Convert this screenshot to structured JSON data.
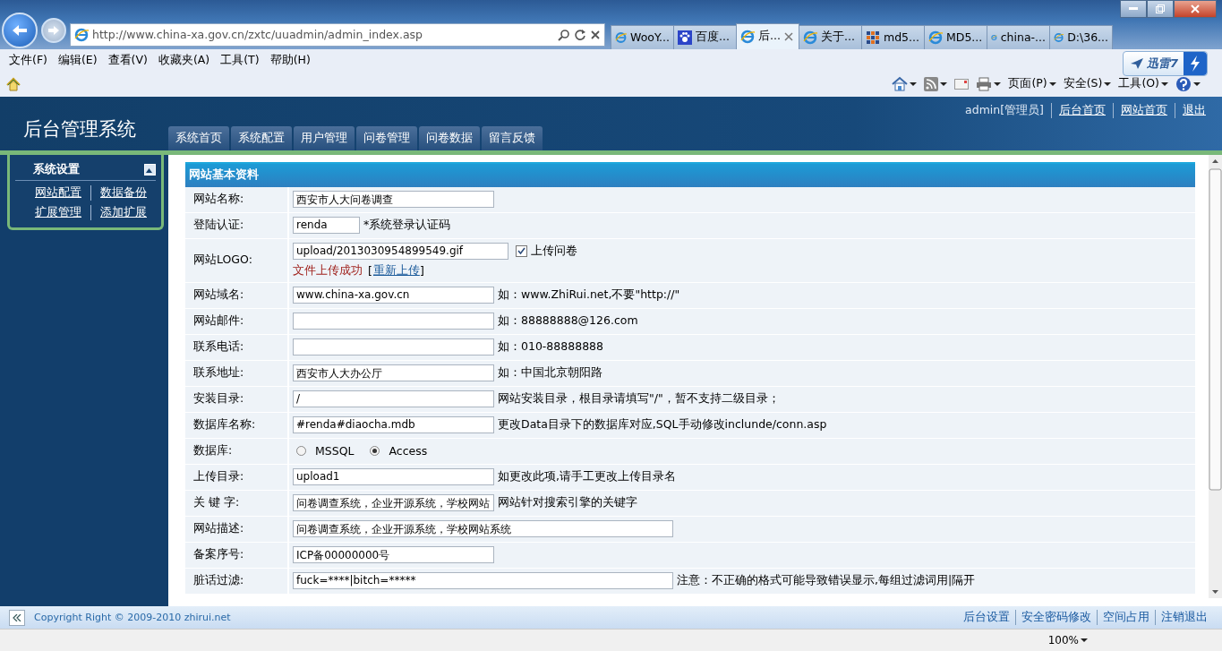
{
  "browser": {
    "address": "http://www.china-xa.gov.cn/zxtc/uuadmin/admin_index.asp",
    "tabs": [
      {
        "label": "WooY...",
        "selected": false
      },
      {
        "label": "百度...",
        "selected": false
      },
      {
        "label": "后...",
        "selected": true
      },
      {
        "label": "关于...",
        "selected": false
      },
      {
        "label": "md5...",
        "selected": false
      },
      {
        "label": "MD5...",
        "selected": false
      },
      {
        "label": "china-...",
        "selected": false
      },
      {
        "label": "D:\\36...",
        "selected": false
      }
    ],
    "addon_badge": "迅雷7",
    "menu": [
      "文件(F)",
      "编辑(E)",
      "查看(V)",
      "收藏夹(A)",
      "工具(T)",
      "帮助(H)"
    ],
    "command_menus": [
      "页面(P)",
      "安全(S)",
      "工具(O)"
    ]
  },
  "page": {
    "title": "后台管理系统",
    "user": "admin[管理员]",
    "header_links": [
      "后台首页",
      "网站首页",
      "退出"
    ],
    "nav_tabs": [
      {
        "label": "系统首页",
        "selected": false
      },
      {
        "label": "系统配置",
        "selected": false
      },
      {
        "label": "用户管理",
        "selected": false
      },
      {
        "label": "问卷管理",
        "selected": false
      },
      {
        "label": "问卷数据",
        "selected": false
      },
      {
        "label": "留言反馈",
        "selected": false
      }
    ],
    "sidebar": {
      "title": "系统设置",
      "expanded": true,
      "links": [
        "网站配置",
        "数据备份",
        "扩展管理",
        "添加扩展"
      ]
    },
    "form": {
      "title": "网站基本资料",
      "rows": [
        {
          "kind": "text",
          "label": "网站名称:",
          "value": "西安市人大问卷调查"
        },
        {
          "kind": "text",
          "label": "登陆认证:",
          "value": "renda",
          "hint": "*系统登录认证码"
        },
        {
          "kind": "upload",
          "label": "网站LOGO:",
          "value": "upload/2013030954899549.gif",
          "checkbox": {
            "label": "上传问卷",
            "checked": true
          },
          "status": "文件上传成功",
          "open_bracket": "[",
          "link": "重新上传",
          "close_bracket": "]"
        },
        {
          "kind": "text",
          "label": "网站域名:",
          "value": "www.china-xa.gov.cn",
          "hint": "如：www.ZhiRui.net,不要\"http://\""
        },
        {
          "kind": "text",
          "label": "网站邮件:",
          "hint": "如：88888888@126.com"
        },
        {
          "kind": "text",
          "label": "联系电话:",
          "hint": "如：010-88888888"
        },
        {
          "kind": "text",
          "label": "联系地址:",
          "value": "西安市人大办公厅",
          "hint": "如：中国北京朝阳路"
        },
        {
          "kind": "text",
          "label": "安装目录:",
          "value": "/",
          "hint": "网站安装目录，根目录请填写\"/\"，暂不支持二级目录；"
        },
        {
          "kind": "text",
          "label": "数据库名称:",
          "value": "#renda#diaocha.mdb",
          "hint": "更改Data目录下的数据库对应,SQL手动修改inclunde/conn.asp"
        },
        {
          "kind": "radio",
          "label": "数据库:",
          "options": [
            {
              "label": "MSSQL",
              "selected": false
            },
            {
              "label": "Access",
              "selected": true
            }
          ]
        },
        {
          "kind": "text",
          "label": "上传目录:",
          "value": "upload1",
          "hint": "如更改此项,请手工更改上传目录名"
        },
        {
          "kind": "text",
          "label": "关 键 字:",
          "value": "问卷调查系统，企业开源系统，学校网站",
          "hint": "网站针对搜索引擎的关键字"
        },
        {
          "kind": "text",
          "label": "网站描述:",
          "value": "问卷调查系统，企业开源系统，学校网站系统"
        },
        {
          "kind": "text",
          "label": "备案序号:",
          "value": "ICP备00000000号"
        },
        {
          "kind": "text",
          "label": "脏话过滤:",
          "value": "fuck=****|bitch=*****",
          "hint": "注意：不正确的格式可能导致错误显示,每组过滤词用|隔开"
        }
      ]
    },
    "footer": {
      "copyright": "Copyright Right © 2009-2010 zhirui.net",
      "links": [
        "后台设置",
        "安全密码修改",
        "空间占用",
        "注销退出"
      ]
    }
  },
  "status_bar": {
    "zoom": "100%"
  }
}
